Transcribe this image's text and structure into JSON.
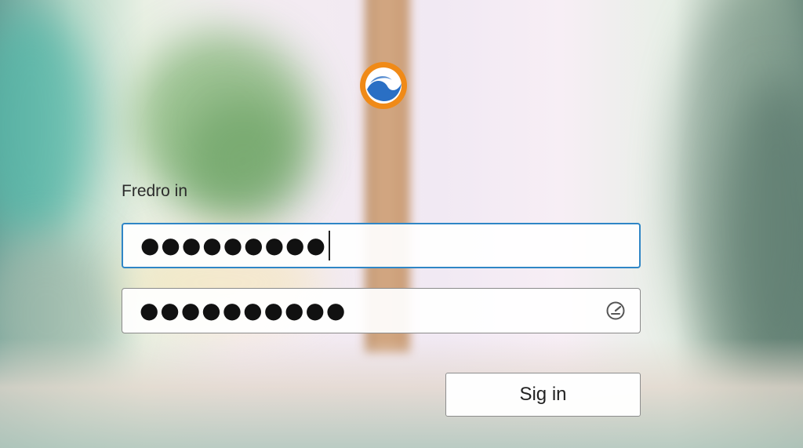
{
  "heading": "Fredro in",
  "fields": {
    "username_masked": "●●●●●●●●●",
    "password_masked": "●●●●●●●●●●"
  },
  "buttons": {
    "sign_in": "Sig in"
  },
  "icons": {
    "logo": "app-logo-icon",
    "reveal": "password-reveal-icon"
  },
  "colors": {
    "focus_border": "#2f86c6",
    "logo_orange": "#f08a17",
    "logo_blue": "#2a6fc4"
  }
}
